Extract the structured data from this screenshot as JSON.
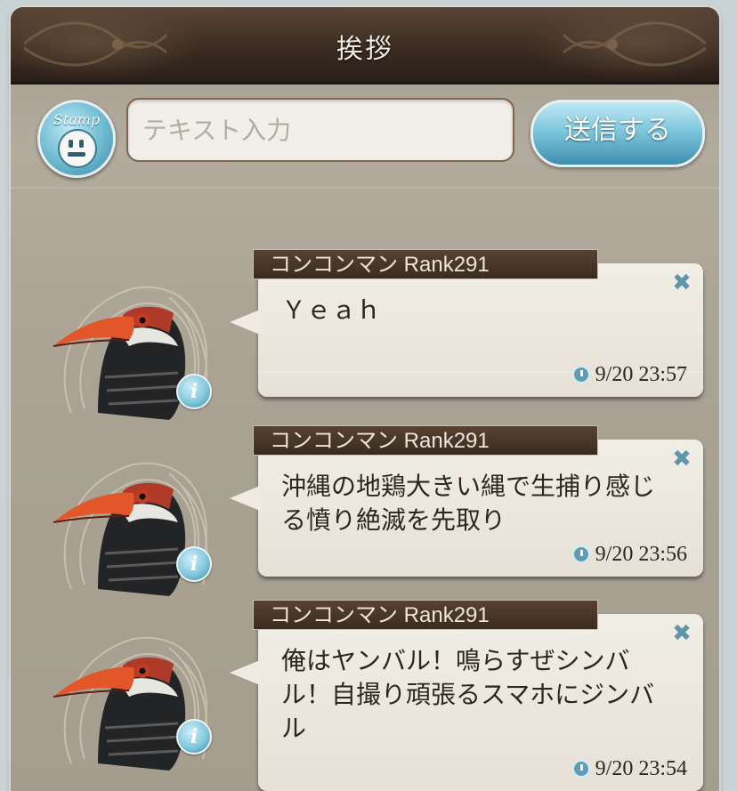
{
  "header": {
    "title": "挨拶"
  },
  "composer": {
    "stamp_label": "Stamp",
    "input_placeholder": "テキスト入力",
    "send_label": "送信する"
  },
  "messages": [
    {
      "author": "コンコンマン Rank291",
      "text": "Ｙｅａｈ",
      "timestamp": "9/20 23:57"
    },
    {
      "author": "コンコンマン Rank291",
      "text": "沖縄の地鶏大きい縄で生捕り感じる憤り絶滅を先取り",
      "timestamp": "9/20 23:56"
    },
    {
      "author": "コンコンマン Rank291",
      "text": "俺はヤンバル！鳴らすぜシンバル！自撮り頑張るスマホにジンバル",
      "timestamp": "9/20 23:54"
    }
  ],
  "icons": {
    "info": "i",
    "close": "✖"
  },
  "colors": {
    "header_bg": "#3b2c22",
    "accent_blue": "#7fc7dd",
    "bubble_bg": "#f1eee6",
    "name_tag_bg": "#3a2b21"
  }
}
